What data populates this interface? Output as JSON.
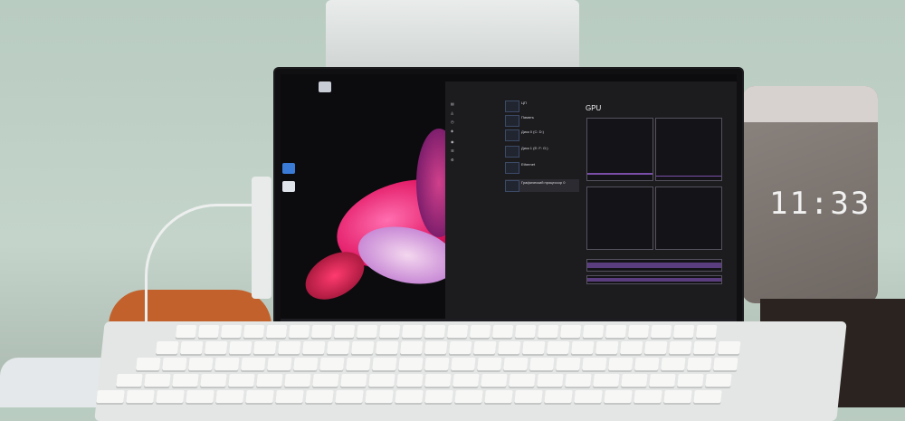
{
  "scene": {
    "clock_display": "11:33",
    "monitor": {
      "task_manager": {
        "selected_section": "GPU",
        "graph_color": "#7a4ea8",
        "nav_items": [
          {
            "icon": "processes-icon"
          },
          {
            "icon": "performance-icon"
          },
          {
            "icon": "history-icon"
          },
          {
            "icon": "startup-icon"
          },
          {
            "icon": "users-icon"
          },
          {
            "icon": "details-icon"
          },
          {
            "icon": "services-icon"
          }
        ],
        "device_rows": [
          {
            "label": "ЦП"
          },
          {
            "label": "Память"
          },
          {
            "label": "Диск 0 (С: D:)"
          },
          {
            "label": "Диск 1 (E: F: G:)"
          },
          {
            "label": "Ethernet"
          },
          {
            "label": "Графический процессор 0"
          }
        ]
      }
    }
  }
}
